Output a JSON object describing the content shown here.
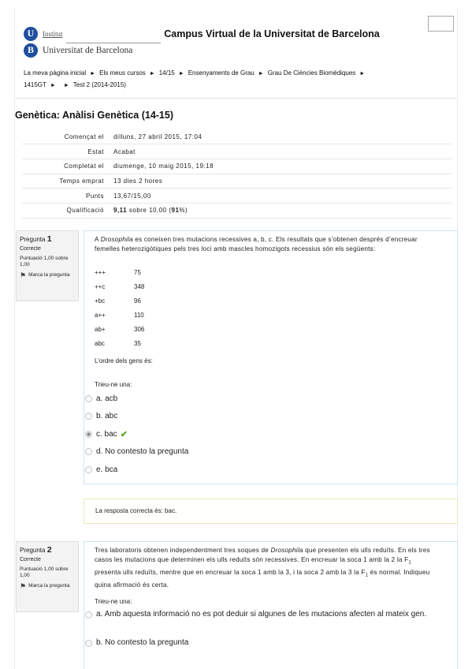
{
  "header": {
    "logo_initial_u": "U",
    "logo_initial_b": "B",
    "logo_sub": "Institut",
    "logo_name": "Universitat de Barcelona",
    "site_title": "Campus Virtual de la Universitat de Barcelona"
  },
  "breadcrumb": {
    "separator": "►",
    "items": [
      "La meva pàgina inicial",
      "Els meus cursos",
      "14/15",
      "Ensenyaments de Grau",
      "Grau De Ciències Biomèdiques",
      "1415GT",
      "Test 2 (2014-2015)"
    ]
  },
  "page_title": "Genètica: Anàlisi Genètica (14-15)",
  "summary": {
    "started_label": "Començat el",
    "started_value": "dilluns, 27 abril 2015, 17:04",
    "state_label": "Estat",
    "state_value": "Acabat",
    "completed_label": "Completat el",
    "completed_value": "diumenge, 10 maig 2015, 19:18",
    "time_label": "Temps emprat",
    "time_value": "13 dies 2 hores",
    "points_label": "Punts",
    "points_value": "13,67/15,00",
    "grade_label": "Qualificació",
    "grade_value_a": "9,11",
    "grade_value_b": " sobre 10,00 (",
    "grade_value_c": "91",
    "grade_value_d": "%)"
  },
  "q1": {
    "label": "Pregunta",
    "number": "1",
    "state": "Correcte",
    "grade": "Puntuació 1,00 sobre 1,00",
    "flag": "Marca la pregunta",
    "text_a": "A ",
    "text_species": "Drosophila",
    "text_b": " es coneixen tres mutacions recessives a, b, c. Els resultats que s’obtenen després d’encreuar femelles heterozigòtiques pels tres loci amb mascles homozigots recessius són els següents:",
    "distribution": [
      {
        "genotype": "+++",
        "count": "75"
      },
      {
        "genotype": "++c",
        "count": "348"
      },
      {
        "genotype": "+bc",
        "count": "96"
      },
      {
        "genotype": "a++",
        "count": "110"
      },
      {
        "genotype": "ab+",
        "count": "306"
      },
      {
        "genotype": "abc",
        "count": "35"
      }
    ],
    "question": "L’ordre dels gens és:",
    "choose": "Trieu-ne una:",
    "answers": [
      "a. acb",
      "b. abc",
      "c. bac",
      "d. No contesto la pregunta",
      "e. bca"
    ],
    "selected_index": 2,
    "feedback": "La resposta correcta és: bac."
  },
  "q2": {
    "label": "Pregunta",
    "number": "2",
    "state": "Correcte",
    "grade": "Puntuació 1,00 sobre 1,00",
    "flag": "Marca la pregunta",
    "text_1": "Tres laboratoris obtenen independentment tres soques de ",
    "text_species": "Drosophila",
    "text_2": " que presenten els ulls reduïts. En els tres casos les mutacions que determinen els ulls reduïts són recessives. En encreuar la soca 1 amb la 2 la F",
    "sub_1": "1",
    "text_3": " presenta ulls reduïts, mentre que en encreuar la soca 1 amb la 3, i la soca 2 amb la 3 la F",
    "sub_2": "1",
    "text_4": " és normal. Indiqueu quina afirmació és certa.",
    "choose": "Trieu-ne una:",
    "answers": [
      "a. Amb aquesta informació no es pot deduir si algunes de les mutacions afecten al mateix gen.",
      "b. No contesto la pregunta"
    ]
  },
  "colors": {
    "logo_blue": "#1f4f9e",
    "correct_green": "#5aa82a",
    "question_border": "#cfe3ec",
    "feedback_border": "#ece8b8"
  }
}
